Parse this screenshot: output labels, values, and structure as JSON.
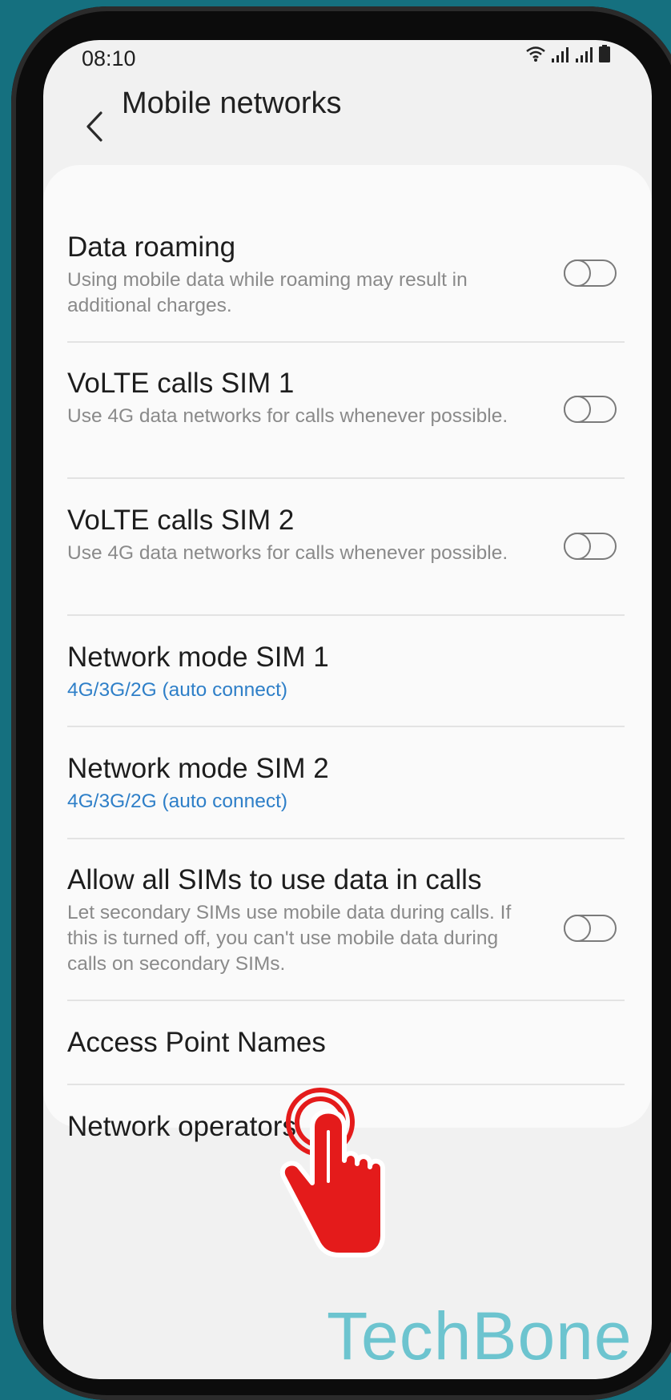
{
  "status_bar": {
    "time": "08:10",
    "icons": [
      "wifi-icon",
      "signal-sim1-icon",
      "signal-sim2-icon",
      "battery-icon"
    ]
  },
  "app_bar": {
    "back_icon": "chevron-left-icon",
    "title": "Mobile networks"
  },
  "settings": [
    {
      "id": "data-roaming",
      "title": "Data roaming",
      "subtitle": "Using mobile data while roaming may result in additional charges.",
      "toggle": false
    },
    {
      "id": "volte-sim1",
      "title": "VoLTE calls SIM 1",
      "subtitle": "Use 4G data networks for calls whenever possible.",
      "toggle": false
    },
    {
      "id": "volte-sim2",
      "title": "VoLTE calls SIM 2",
      "subtitle": "Use 4G data networks for calls whenever possible.",
      "toggle": false
    },
    {
      "id": "network-mode-sim1",
      "title": "Network mode SIM 1",
      "value": "4G/3G/2G (auto connect)"
    },
    {
      "id": "network-mode-sim2",
      "title": "Network mode SIM 2",
      "value": "4G/3G/2G (auto connect)"
    },
    {
      "id": "data-in-calls",
      "title": "Allow all SIMs to use data in calls",
      "subtitle": "Let secondary SIMs use mobile data during calls. If this is turned off, you can't use mobile data during calls on secondary SIMs.",
      "toggle": false
    },
    {
      "id": "apn",
      "title": "Access Point Names"
    },
    {
      "id": "network-operators",
      "title": "Network operators"
    }
  ],
  "watermark": "TechBone",
  "colors": {
    "background": "#15707f",
    "accent_blue": "#2e7fc8",
    "tap_hand": "#e41b1b",
    "watermark": "#5fc0cc"
  }
}
